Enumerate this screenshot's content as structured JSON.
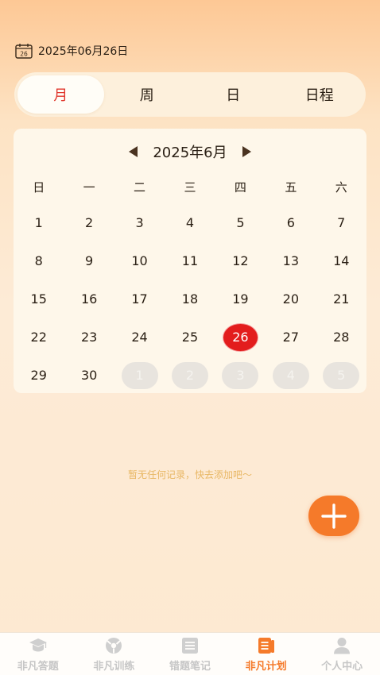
{
  "header": {
    "date_text": "2025年06月26日",
    "icon_day": "26"
  },
  "view_tabs": [
    {
      "label": "月",
      "active": true
    },
    {
      "label": "周",
      "active": false
    },
    {
      "label": "日",
      "active": false
    },
    {
      "label": "日程",
      "active": false
    }
  ],
  "calendar": {
    "month_title": "2025年6月",
    "weekdays": [
      "日",
      "一",
      "二",
      "三",
      "四",
      "五",
      "六"
    ],
    "days": [
      {
        "d": "1",
        "type": "cur"
      },
      {
        "d": "2",
        "type": "cur"
      },
      {
        "d": "3",
        "type": "cur"
      },
      {
        "d": "4",
        "type": "cur"
      },
      {
        "d": "5",
        "type": "cur"
      },
      {
        "d": "6",
        "type": "cur"
      },
      {
        "d": "7",
        "type": "cur"
      },
      {
        "d": "8",
        "type": "cur"
      },
      {
        "d": "9",
        "type": "cur"
      },
      {
        "d": "10",
        "type": "cur"
      },
      {
        "d": "11",
        "type": "cur"
      },
      {
        "d": "12",
        "type": "cur"
      },
      {
        "d": "13",
        "type": "cur"
      },
      {
        "d": "14",
        "type": "cur"
      },
      {
        "d": "15",
        "type": "cur"
      },
      {
        "d": "16",
        "type": "cur"
      },
      {
        "d": "17",
        "type": "cur"
      },
      {
        "d": "18",
        "type": "cur"
      },
      {
        "d": "19",
        "type": "cur"
      },
      {
        "d": "20",
        "type": "cur"
      },
      {
        "d": "21",
        "type": "cur"
      },
      {
        "d": "22",
        "type": "cur"
      },
      {
        "d": "23",
        "type": "cur"
      },
      {
        "d": "24",
        "type": "cur"
      },
      {
        "d": "25",
        "type": "cur"
      },
      {
        "d": "26",
        "type": "today"
      },
      {
        "d": "27",
        "type": "cur"
      },
      {
        "d": "28",
        "type": "cur"
      },
      {
        "d": "29",
        "type": "cur"
      },
      {
        "d": "30",
        "type": "cur"
      },
      {
        "d": "1",
        "type": "other"
      },
      {
        "d": "2",
        "type": "other"
      },
      {
        "d": "3",
        "type": "other"
      },
      {
        "d": "4",
        "type": "other"
      },
      {
        "d": "5",
        "type": "other"
      }
    ]
  },
  "empty_message": "暂无任何记录，快去添加吧～",
  "tabbar": [
    {
      "label": "非凡答题",
      "icon": "graduation-cap-icon",
      "active": false
    },
    {
      "label": "非凡训练",
      "icon": "ball-icon",
      "active": false
    },
    {
      "label": "错题笔记",
      "icon": "notebook-icon",
      "active": false
    },
    {
      "label": "非凡计划",
      "icon": "plan-list-icon",
      "active": true
    },
    {
      "label": "个人中心",
      "icon": "person-icon",
      "active": false
    }
  ],
  "colors": {
    "accent": "#f57a2a",
    "today": "#e31d1d",
    "active_tab_text": "#e0352b"
  }
}
